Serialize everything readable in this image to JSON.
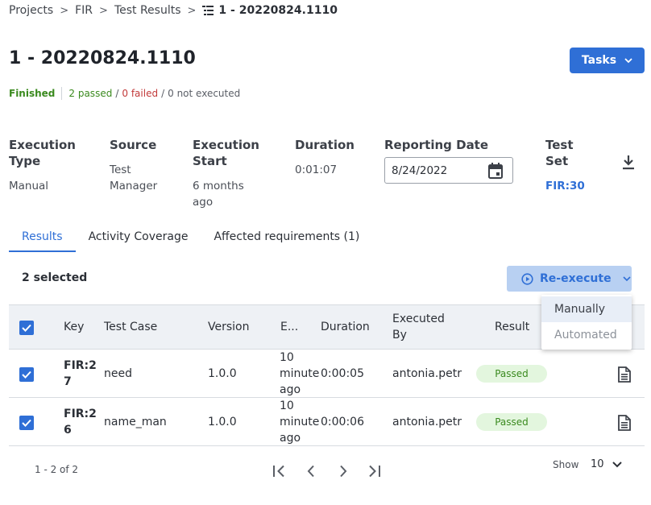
{
  "breadcrumb": {
    "items": [
      "Projects",
      "FIR",
      "Test Results"
    ],
    "current": "1 - 20220824.1110",
    "separator": ">"
  },
  "header": {
    "title": "1 - 20220824.1110",
    "tasks_label": "Tasks"
  },
  "status": {
    "state": "Finished",
    "passed": "2 passed",
    "failed": "0 failed",
    "not_executed": "0 not executed",
    "slash": "/"
  },
  "details": {
    "execution_type": {
      "label_1": "Execution",
      "label_2": "Type",
      "value": "Manual"
    },
    "source": {
      "label": "Source",
      "value_1": "Test",
      "value_2": "Manager"
    },
    "execution_start": {
      "label_1": "Execution",
      "label_2": "Start",
      "value_1": "6 months",
      "value_2": "ago"
    },
    "duration": {
      "label": "Duration",
      "value": "0:01:07"
    },
    "reporting_date": {
      "label": "Reporting Date",
      "value": "8/24/2022"
    },
    "test_set": {
      "label_1": "Test",
      "label_2": "Set",
      "value": "FIR:30"
    }
  },
  "tabs": [
    {
      "label": "Results",
      "active": true
    },
    {
      "label": "Activity Coverage",
      "active": false
    },
    {
      "label": "Affected requirements (1)",
      "active": false
    }
  ],
  "toolbar": {
    "selected_text": "2 selected",
    "reexecute_label": "Re-execute",
    "dropdown": [
      "Manually",
      "Automated"
    ]
  },
  "table": {
    "headers": {
      "key": "Key",
      "test_case": "Test Case",
      "version": "Version",
      "e": "E...",
      "duration": "Duration",
      "executed_by_1": "Executed",
      "executed_by_2": "By",
      "result": "Result"
    },
    "rows": [
      {
        "key_1": "FIR:2",
        "key_2": "7",
        "test_case": "need",
        "version": "1.0.0",
        "when_1": "10",
        "when_2": "minute",
        "when_3": "ago",
        "duration": "0:00:05",
        "executed_by": "antonia.petre",
        "result": "Passed"
      },
      {
        "key_1": "FIR:2",
        "key_2": "6",
        "test_case": "name_man",
        "version": "1.0.0",
        "when_1": "10",
        "when_2": "minute",
        "when_3": "ago",
        "duration": "0:00:06",
        "executed_by": "antonia.petre",
        "result": "Passed"
      }
    ]
  },
  "pagination": {
    "count": "1 - 2 of 2",
    "show_label": "Show",
    "page_size": "10"
  },
  "colors": {
    "primary": "#2f6fd6",
    "success": "#3a8a1e",
    "failure": "#c23a3a",
    "success_bg": "#e3f6de"
  }
}
